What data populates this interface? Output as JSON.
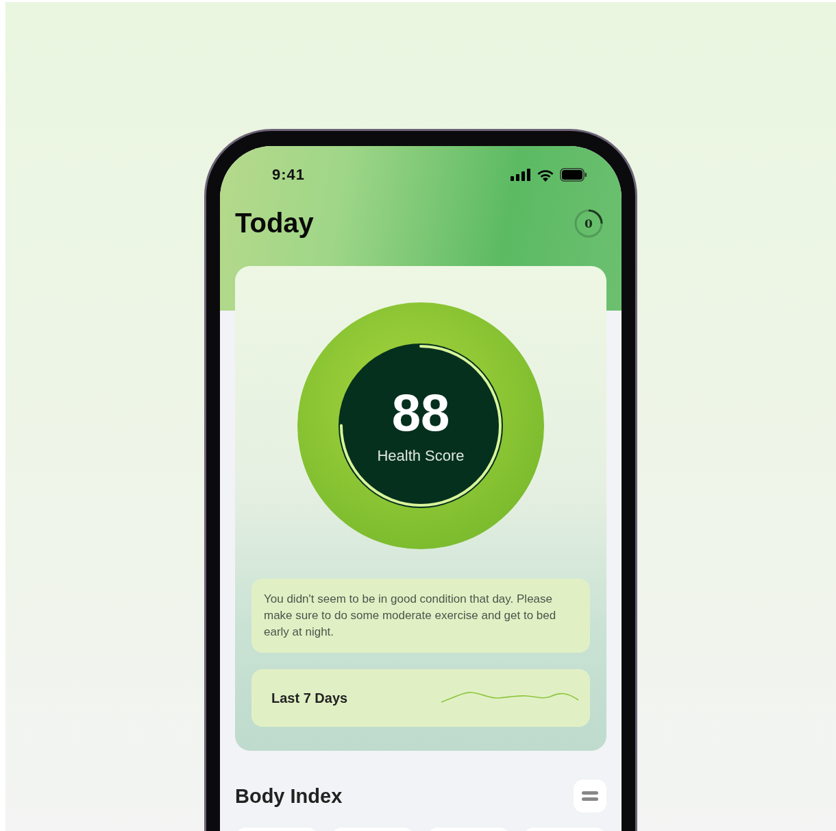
{
  "status_bar": {
    "time": "9:41"
  },
  "header": {
    "title": "Today",
    "ring_button": {
      "label": "0"
    }
  },
  "score": {
    "value": "88",
    "label": "Health Score"
  },
  "message": "You didn't seem to be in good condition that day. Please make sure to do some moderate exercise and get to bed early at night.",
  "trend": {
    "label": "Last 7 Days"
  },
  "body_index": {
    "title": "Body Index",
    "cards": [
      {
        "kind": "card"
      },
      {
        "kind": "card"
      },
      {
        "kind": "card"
      },
      {
        "kind": "card"
      }
    ]
  }
}
